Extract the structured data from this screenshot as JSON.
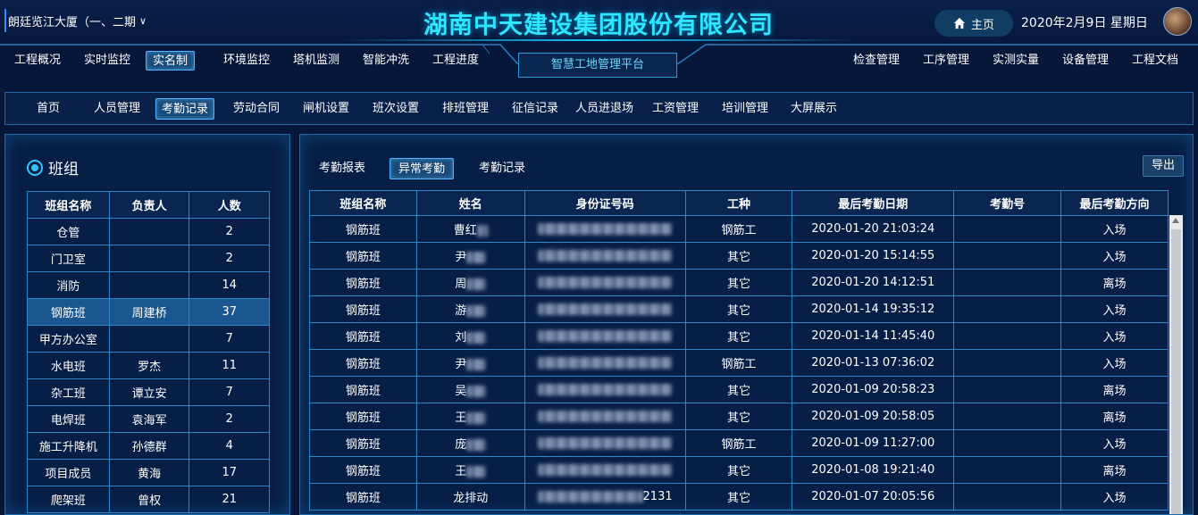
{
  "header": {
    "project": "朗廷览江大厦（一、二期",
    "company_title": "湖南中天建设集团股份有限公司",
    "home_label": "主页",
    "date": "2020年2月9日 星期日"
  },
  "main_nav": {
    "left": [
      "工程概况",
      "实时监控",
      "实名制",
      "环境监控",
      "塔机监测",
      "智能冲洗",
      "工程进度"
    ],
    "active": "实名制",
    "platform": "智慧工地管理平台",
    "right": [
      "检查管理",
      "工序管理",
      "实测实量",
      "设备管理",
      "工程文档"
    ]
  },
  "sub_nav": {
    "items": [
      "首页",
      "人员管理",
      "考勤记录",
      "劳动合同",
      "闸机设置",
      "班次设置",
      "排班管理",
      "征信记录",
      "人员进退场",
      "工资管理",
      "培训管理",
      "大屏展示"
    ],
    "active": "考勤记录"
  },
  "team_panel": {
    "title": "班组",
    "headers": [
      "班组名称",
      "负责人",
      "人数"
    ],
    "rows": [
      [
        "仓管",
        "",
        "2"
      ],
      [
        "门卫室",
        "",
        "2"
      ],
      [
        "消防",
        "",
        "14"
      ],
      [
        "钢筋班",
        "周建桥",
        "37"
      ],
      [
        "甲方办公室",
        "",
        "7"
      ],
      [
        "水电班",
        "罗杰",
        "11"
      ],
      [
        "杂工班",
        "谭立安",
        "7"
      ],
      [
        "电焊班",
        "袁海军",
        "2"
      ],
      [
        "施工升降机",
        "孙德群",
        "4"
      ],
      [
        "项目成员",
        "黄海",
        "17"
      ],
      [
        "爬架班",
        "曾权",
        "21"
      ]
    ],
    "selected_row": 3
  },
  "attendance": {
    "tabs": [
      "考勤报表",
      "异常考勤",
      "考勤记录"
    ],
    "active_tab": "异常考勤",
    "export_label": "导出",
    "headers": [
      "班组名称",
      "姓名",
      "身份证号码",
      "工种",
      "最后考勤日期",
      "考勤号",
      "最后考勤方向"
    ],
    "rows": [
      [
        "钢筋班",
        "曹红",
        "",
        "钢筋工",
        "2020-01-20 21:03:24",
        "",
        "入场"
      ],
      [
        "钢筋班",
        "尹",
        "",
        "其它",
        "2020-01-20 15:14:55",
        "",
        "入场"
      ],
      [
        "钢筋班",
        "周",
        "",
        "其它",
        "2020-01-20 14:12:51",
        "",
        "离场"
      ],
      [
        "钢筋班",
        "游",
        "",
        "其它",
        "2020-01-14 19:35:12",
        "",
        "入场"
      ],
      [
        "钢筋班",
        "刘",
        "",
        "其它",
        "2020-01-14 11:45:40",
        "",
        "入场"
      ],
      [
        "钢筋班",
        "尹",
        "",
        "钢筋工",
        "2020-01-13 07:36:02",
        "",
        "入场"
      ],
      [
        "钢筋班",
        "吴",
        "",
        "其它",
        "2020-01-09 20:58:23",
        "",
        "离场"
      ],
      [
        "钢筋班",
        "王",
        "",
        "其它",
        "2020-01-09 20:58:05",
        "",
        "离场"
      ],
      [
        "钢筋班",
        "庞",
        "",
        "钢筋工",
        "2020-01-09 11:27:00",
        "",
        "入场"
      ],
      [
        "钢筋班",
        "王",
        "",
        "其它",
        "2020-01-08 19:21:40",
        "",
        "离场"
      ],
      [
        "钢筋班",
        "龙排动",
        "2131",
        "其它",
        "2020-01-07 20:05:56",
        "",
        "入场"
      ]
    ]
  }
}
